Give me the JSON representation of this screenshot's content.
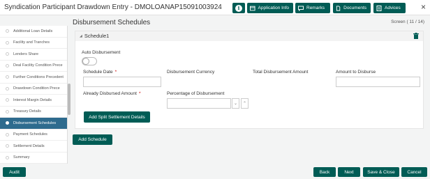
{
  "header": {
    "title": "Syndication Participant Drawdown Entry - DMOLOANAP15091003924",
    "buttons": {
      "info": "i",
      "application_info": "Application Info",
      "remarks": "Remarks",
      "documents": "Documents",
      "advices": "Advices"
    },
    "close": "×"
  },
  "sidebar": {
    "items": [
      {
        "label": "Additional Loan Details",
        "active": false
      },
      {
        "label": "Facility and Tranches",
        "active": false
      },
      {
        "label": "Lenders Share",
        "active": false
      },
      {
        "label": "Deal Facility Condition Prece",
        "active": false
      },
      {
        "label": "Further Conditions Precedent",
        "active": false
      },
      {
        "label": "Drawdown Condition Prece",
        "active": false
      },
      {
        "label": "Interest Margin Details",
        "active": false
      },
      {
        "label": "Treasury Details",
        "active": false
      },
      {
        "label": "Disbursement Schedules",
        "active": true
      },
      {
        "label": "Payment Schedules",
        "active": false
      },
      {
        "label": "Settlement Details",
        "active": false
      },
      {
        "label": "Summary",
        "active": false
      }
    ]
  },
  "main": {
    "title": "Disbursement Schedules",
    "screen_indicator": "Screen ( 11 / 14)",
    "schedule": {
      "title": "Schedule1",
      "auto_disbursement_label": "Auto Disbursement",
      "schedule_date_label": "Schedule Date",
      "schedule_date_value": "",
      "required_mark": "*",
      "disbursement_currency_label": "Disbursement Currency",
      "total_disbursement_amount_label": "Total Disbursement Amount",
      "amount_to_disburse_label": "Amount to Disburse",
      "amount_to_disburse_value": "",
      "already_disbursed_amount_label": "Already Disbursed Amount",
      "percentage_of_disbursement_label": "Percentage of Disbursement",
      "percentage_of_disbursement_value": "",
      "add_split_settlement_label": "Add Split Settlement Details"
    },
    "add_schedule_label": "Add Schedule"
  },
  "footer": {
    "audit": "Audit",
    "back": "Back",
    "next": "Next",
    "save_close": "Save & Close",
    "cancel": "Cancel"
  },
  "colors": {
    "primary": "#005c55",
    "sidebar_active": "#2e6b8e"
  }
}
